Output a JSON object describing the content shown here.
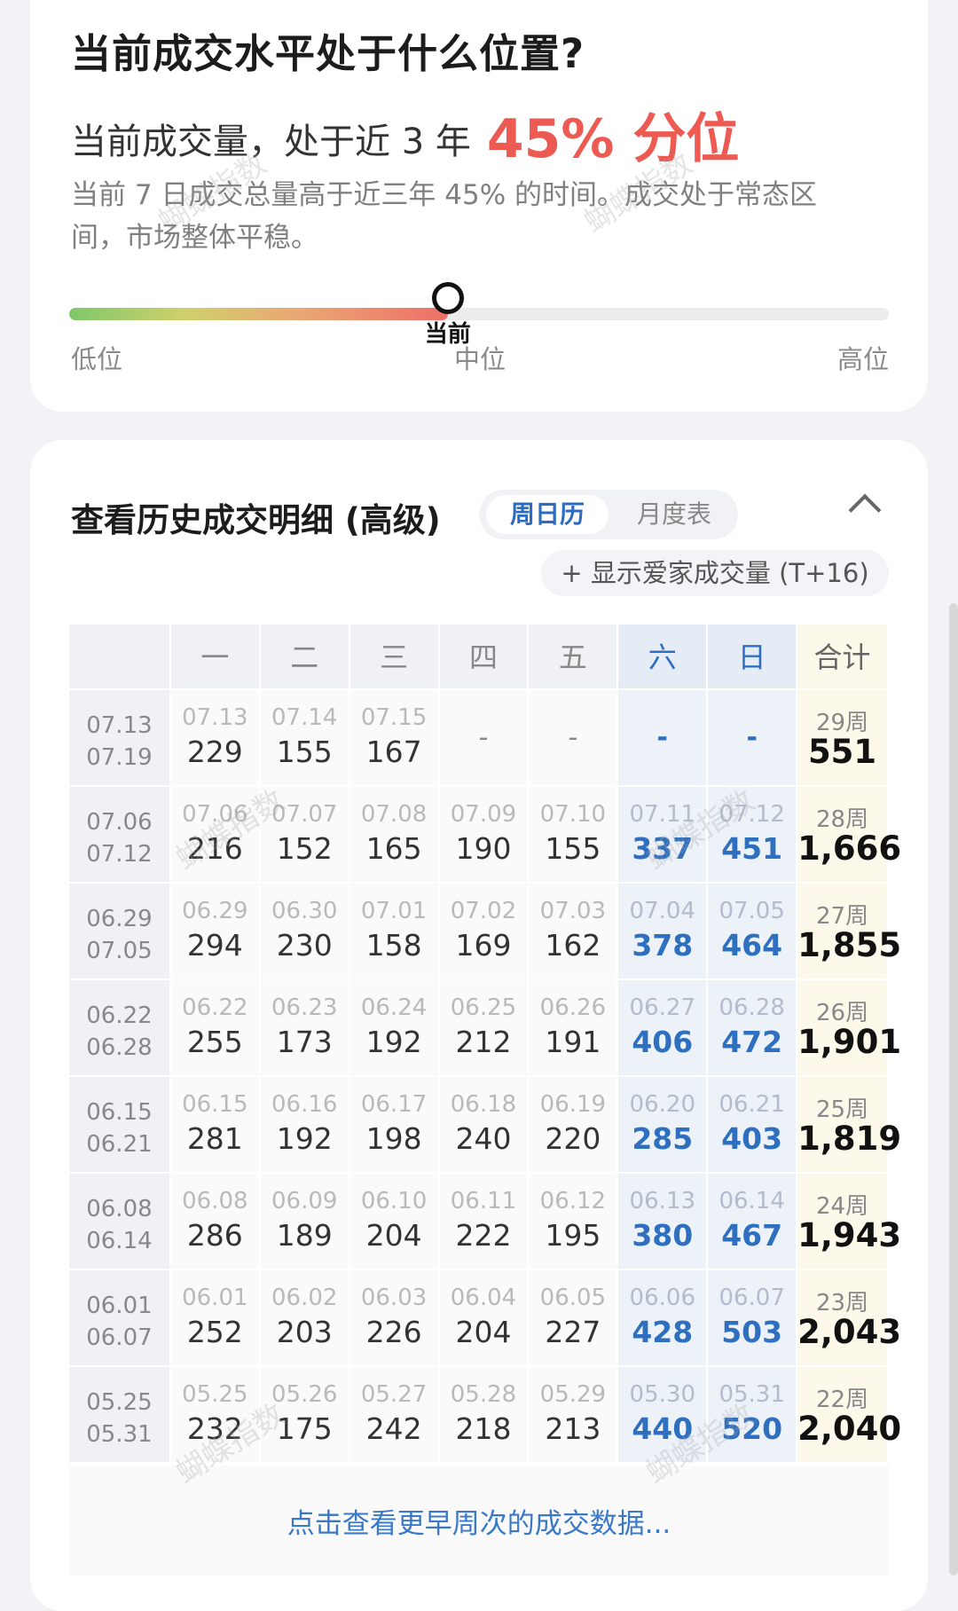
{
  "level": {
    "title": "当前成交水平处于什么位置?",
    "summary_prefix": "当前成交量，处于近 3 年",
    "percentile": "45% 分位",
    "percentile_value": 0.45,
    "description": "当前 7 日成交总量高于近三年 45% 的时间。成交处于常态区间，市场整体平稳。",
    "marker_label": "当前",
    "scale_low": "低位",
    "scale_mid": "中位",
    "scale_high": "高位"
  },
  "history": {
    "title": "查看历史成交明细 (高级)",
    "tab_active": "周日历",
    "tab_inactive": "月度表",
    "show_button": "+ 显示爱家成交量 (T+16)",
    "headers": [
      "",
      "一",
      "二",
      "三",
      "四",
      "五",
      "六",
      "日",
      "合计"
    ],
    "rows": [
      {
        "start": "07.13",
        "end": "07.19",
        "days": [
          [
            "07.13",
            "229"
          ],
          [
            "07.14",
            "155"
          ],
          [
            "07.15",
            "167"
          ],
          [
            "",
            "-"
          ],
          [
            "",
            "-"
          ],
          [
            "",
            "-"
          ],
          [
            "",
            "-"
          ]
        ],
        "week": "29周",
        "total": "551"
      },
      {
        "start": "07.06",
        "end": "07.12",
        "days": [
          [
            "07.06",
            "216"
          ],
          [
            "07.07",
            "152"
          ],
          [
            "07.08",
            "165"
          ],
          [
            "07.09",
            "190"
          ],
          [
            "07.10",
            "155"
          ],
          [
            "07.11",
            "337"
          ],
          [
            "07.12",
            "451"
          ]
        ],
        "week": "28周",
        "total": "1,666"
      },
      {
        "start": "06.29",
        "end": "07.05",
        "days": [
          [
            "06.29",
            "294"
          ],
          [
            "06.30",
            "230"
          ],
          [
            "07.01",
            "158"
          ],
          [
            "07.02",
            "169"
          ],
          [
            "07.03",
            "162"
          ],
          [
            "07.04",
            "378"
          ],
          [
            "07.05",
            "464"
          ]
        ],
        "week": "27周",
        "total": "1,855"
      },
      {
        "start": "06.22",
        "end": "06.28",
        "days": [
          [
            "06.22",
            "255"
          ],
          [
            "06.23",
            "173"
          ],
          [
            "06.24",
            "192"
          ],
          [
            "06.25",
            "212"
          ],
          [
            "06.26",
            "191"
          ],
          [
            "06.27",
            "406"
          ],
          [
            "06.28",
            "472"
          ]
        ],
        "week": "26周",
        "total": "1,901"
      },
      {
        "start": "06.15",
        "end": "06.21",
        "days": [
          [
            "06.15",
            "281"
          ],
          [
            "06.16",
            "192"
          ],
          [
            "06.17",
            "198"
          ],
          [
            "06.18",
            "240"
          ],
          [
            "06.19",
            "220"
          ],
          [
            "06.20",
            "285"
          ],
          [
            "06.21",
            "403"
          ]
        ],
        "week": "25周",
        "total": "1,819"
      },
      {
        "start": "06.08",
        "end": "06.14",
        "days": [
          [
            "06.08",
            "286"
          ],
          [
            "06.09",
            "189"
          ],
          [
            "06.10",
            "204"
          ],
          [
            "06.11",
            "222"
          ],
          [
            "06.12",
            "195"
          ],
          [
            "06.13",
            "380"
          ],
          [
            "06.14",
            "467"
          ]
        ],
        "week": "24周",
        "total": "1,943"
      },
      {
        "start": "06.01",
        "end": "06.07",
        "days": [
          [
            "06.01",
            "252"
          ],
          [
            "06.02",
            "203"
          ],
          [
            "06.03",
            "226"
          ],
          [
            "06.04",
            "204"
          ],
          [
            "06.05",
            "227"
          ],
          [
            "06.06",
            "428"
          ],
          [
            "06.07",
            "503"
          ]
        ],
        "week": "23周",
        "total": "2,043"
      },
      {
        "start": "05.25",
        "end": "05.31",
        "days": [
          [
            "05.25",
            "232"
          ],
          [
            "05.26",
            "175"
          ],
          [
            "05.27",
            "242"
          ],
          [
            "05.28",
            "218"
          ],
          [
            "05.29",
            "213"
          ],
          [
            "05.30",
            "440"
          ],
          [
            "05.31",
            "520"
          ]
        ],
        "week": "22周",
        "total": "2,040"
      }
    ],
    "more_link": "点击查看更早周次的成交数据..."
  },
  "watermark": "蝴蝶指数",
  "colors": {
    "accent_red": "#ec5a52",
    "accent_blue": "#2f6fbf",
    "total_bg": "#fdf9ea"
  }
}
